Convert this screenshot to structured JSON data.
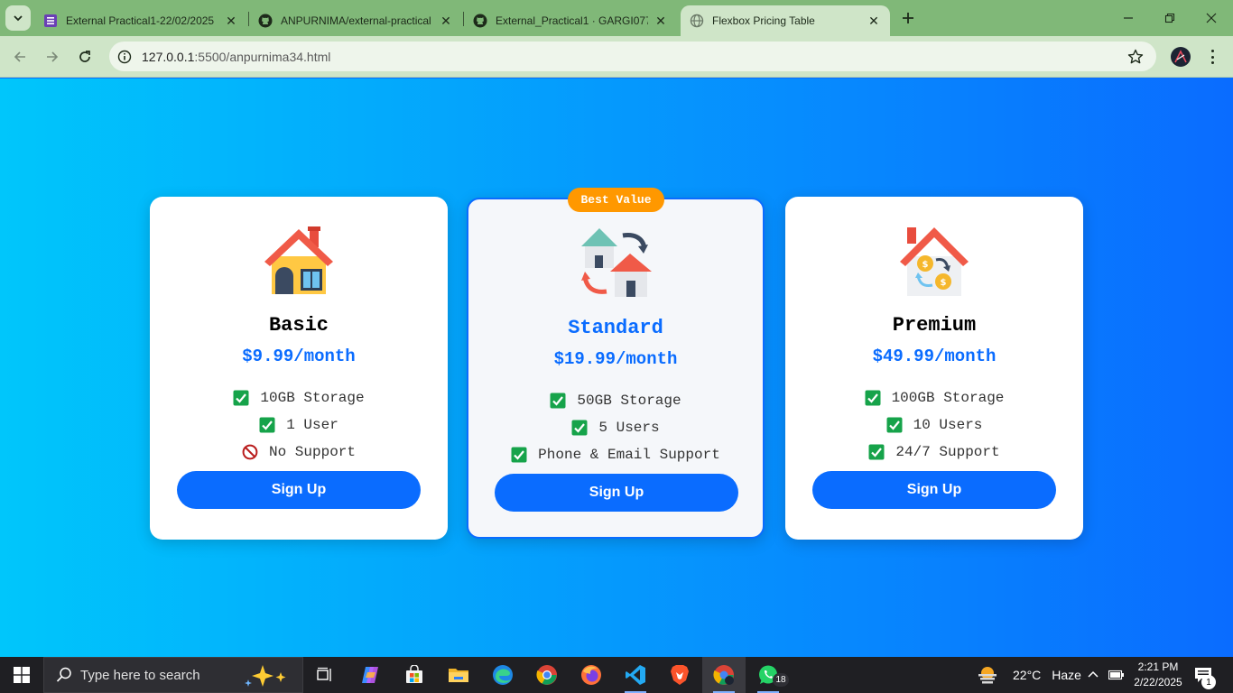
{
  "browser": {
    "tabs": [
      {
        "title": "External Practical1-22/02/2025",
        "active": false
      },
      {
        "title": "ANPURNIMA/external-practical",
        "active": false
      },
      {
        "title": "External_Practical1 · GARGI077/",
        "active": false
      },
      {
        "title": "Flexbox Pricing Table",
        "active": true
      }
    ],
    "url_host": "127.0.0.1",
    "url_path": ":5500/anpurnima34.html"
  },
  "pricing": {
    "badge": "Best Value",
    "plans": [
      {
        "name": "Basic",
        "price": "$9.99/month",
        "icon": "house-icon",
        "features": [
          {
            "text": "10GB Storage",
            "icon": "check-icon"
          },
          {
            "text": "1 User",
            "icon": "check-icon"
          },
          {
            "text": "No Support",
            "icon": "prohibited-icon"
          }
        ],
        "button": "Sign Up"
      },
      {
        "name": "Standard",
        "price": "$19.99/month",
        "icon": "house-exchange-icon",
        "features": [
          {
            "text": "50GB Storage",
            "icon": "check-icon"
          },
          {
            "text": "5 Users",
            "icon": "check-icon"
          },
          {
            "text": "Phone & Email Support",
            "icon": "check-icon"
          }
        ],
        "button": "Sign Up"
      },
      {
        "name": "Premium",
        "price": "$49.99/month",
        "icon": "house-money-icon",
        "features": [
          {
            "text": "100GB Storage",
            "icon": "check-icon"
          },
          {
            "text": "10 Users",
            "icon": "check-icon"
          },
          {
            "text": "24/7 Support",
            "icon": "check-icon"
          }
        ],
        "button": "Sign Up"
      }
    ]
  },
  "taskbar": {
    "search_placeholder": "Type here to search",
    "whatsapp_badge": "18",
    "weather_temp": "22°C",
    "weather_text": "Haze",
    "time": "2:21 PM",
    "date": "2/22/2025",
    "notification_count": "1"
  },
  "colors": {
    "accent": "#0a6cff",
    "badge": "#ff9800",
    "gradient_start": "#00c6fb",
    "gradient_end": "#0a6cff",
    "check_green": "#16a34a"
  }
}
